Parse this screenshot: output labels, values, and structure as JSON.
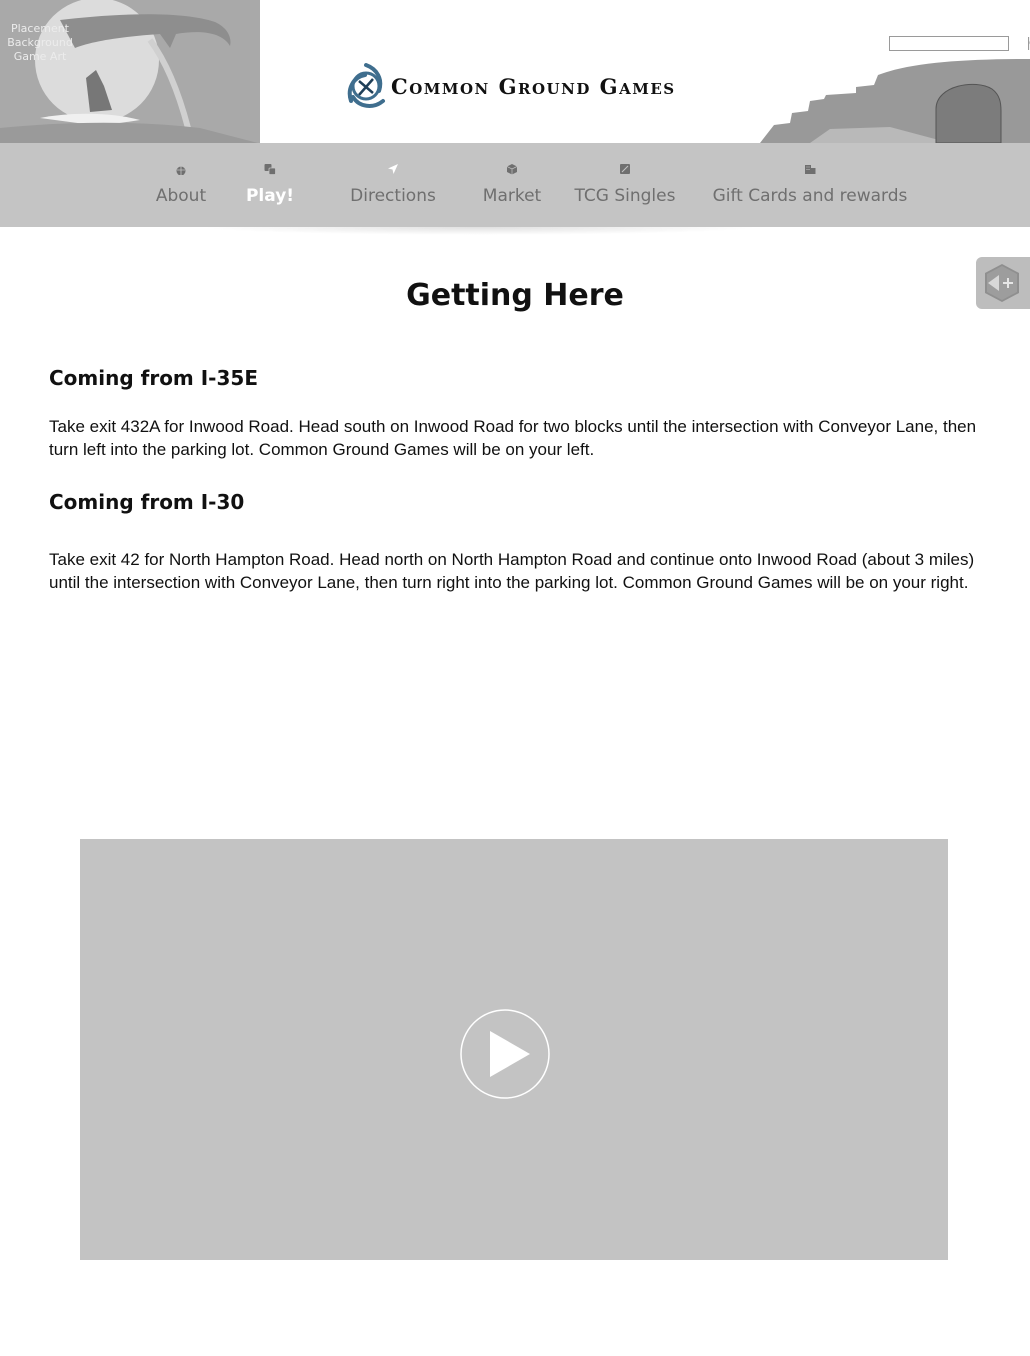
{
  "header": {
    "placeholder_lines": [
      "Placement",
      "Background",
      "Game Art"
    ],
    "logo_text": "Common Ground Games",
    "search": {
      "placeholder": "",
      "button_icon": "search-icon"
    }
  },
  "nav": {
    "items": [
      {
        "label": "About",
        "icon": "globe-icon",
        "active": false
      },
      {
        "label": "Play!",
        "icon": "dice-icon",
        "active": true
      },
      {
        "label": "Directions",
        "icon": "location-arrow-icon",
        "active": false
      },
      {
        "label": "Market",
        "icon": "cube-icon",
        "active": false
      },
      {
        "label": "TCG Singles",
        "icon": "card-icon",
        "active": false
      },
      {
        "label": "Gift Cards and rewards",
        "icon": "building-icon",
        "active": false
      }
    ]
  },
  "side_tab": {
    "icon": "share-plus-icon"
  },
  "main": {
    "title": "Getting Here",
    "sections": [
      {
        "heading": "Coming from I-35E",
        "text": "Take exit 432A for Inwood Road.  Head south on Inwood Road for two blocks until the intersection with Conveyor Lane, then turn left into the parking lot.  Common Ground Games will be on your left."
      },
      {
        "heading": "Coming from I-30",
        "text": "Take exit 42 for North Hampton Road.  Head north on North Hampton Road and continue onto Inwood Road (about 3 miles) until the intersection with Conveyor Lane, then turn right into the parking lot.  Common Ground Games will be on your right."
      }
    ]
  },
  "video": {
    "icon": "play-icon"
  },
  "colors": {
    "nav_bg": "#c4c4c4",
    "nav_text": "#6f6f6f",
    "nav_active": "#ffffff",
    "video_bg": "#c3c3c3"
  }
}
